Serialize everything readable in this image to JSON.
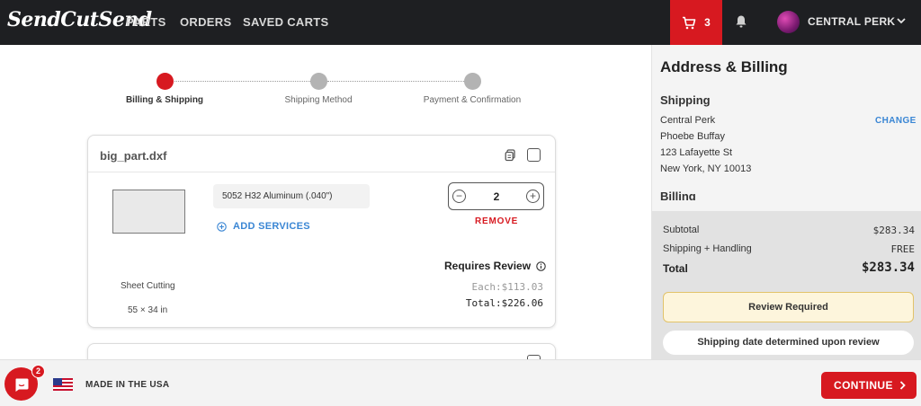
{
  "nav": {
    "logo": "SendCutSend",
    "links": [
      "PARTS",
      "ORDERS",
      "SAVED CARTS"
    ],
    "cart_count": "3",
    "account_name": "CENTRAL PERK"
  },
  "stepper": {
    "steps": [
      {
        "label": "Billing & Shipping",
        "active": true
      },
      {
        "label": "Shipping Method",
        "active": false
      },
      {
        "label": "Payment & Confirmation",
        "active": false
      }
    ]
  },
  "part": {
    "filename": "big_part.dxf",
    "material": "5052 H32 Aluminum (.040\")",
    "add_services": "ADD SERVICES",
    "quantity": "2",
    "remove": "REMOVE",
    "requires_review": "Requires Review",
    "each": "Each:$113.03",
    "total": "Total:$226.06",
    "process": "Sheet Cutting",
    "dimensions": "55 × 34 in"
  },
  "sidebar": {
    "title": "Address & Billing",
    "shipping_heading": "Shipping",
    "change": "CHANGE",
    "address": [
      "Central Perk",
      "Phoebe Buffay",
      "123 Lafayette St",
      "New York, NY 10013"
    ],
    "billing_heading": "Billing",
    "summary": {
      "subtotal_label": "Subtotal",
      "subtotal_value": "$283.34",
      "shipping_label": "Shipping + Handling",
      "shipping_value": "FREE",
      "total_label": "Total",
      "total_value": "$283.34"
    },
    "review_required": "Review Required",
    "shipping_date": "Shipping date determined upon review"
  },
  "footer": {
    "chat_badge": "2",
    "made_in": "MADE IN THE USA",
    "continue": "CONTINUE"
  },
  "colors": {
    "brand_red": "#d71920",
    "nav_bg": "#1e1f22",
    "link_blue": "#3a86d4",
    "step_active": "#d71920",
    "step_inactive": "#b3b3b3"
  }
}
